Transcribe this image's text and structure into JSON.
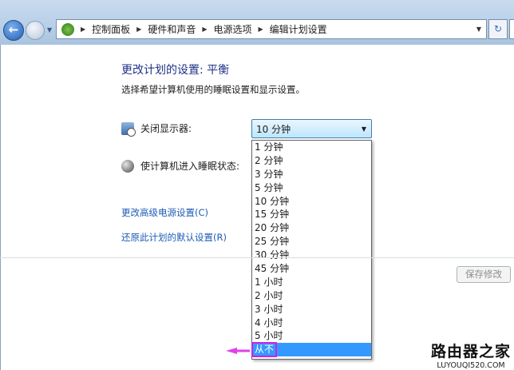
{
  "breadcrumb": [
    "控制面板",
    "硬件和声音",
    "电源选项",
    "编辑计划设置"
  ],
  "title": "更改计划的设置: 平衡",
  "subtitle": "选择希望计算机使用的睡眠设置和显示设置。",
  "display_label": "关闭显示器:",
  "sleep_label": "使计算机进入睡眠状态:",
  "display_value": "10 分钟",
  "options": [
    "1 分钟",
    "2 分钟",
    "3 分钟",
    "5 分钟",
    "10 分钟",
    "15 分钟",
    "20 分钟",
    "25 分钟",
    "30 分钟",
    "45 分钟",
    "1 小时",
    "2 小时",
    "3 小时",
    "4 小时",
    "5 小时",
    "从不"
  ],
  "links": {
    "advanced": "更改高级电源设置(C)",
    "restore": "还原此计划的默认设置(R)"
  },
  "save_label": "保存修改",
  "watermark": {
    "cn": "路由器之家",
    "url": "LUYOUQI520.COM"
  },
  "colors": {
    "highlight": "#3399ff",
    "annotation": "#d020e0"
  }
}
